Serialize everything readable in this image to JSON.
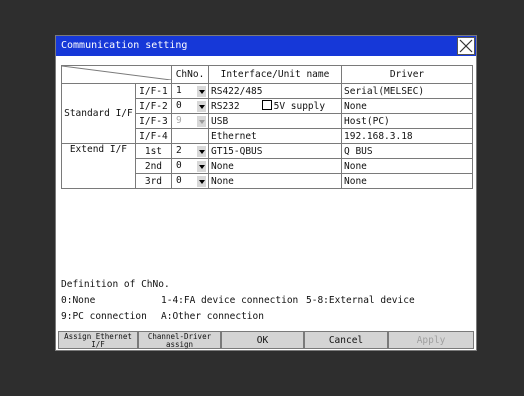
{
  "dialog": {
    "title": "Communication setting",
    "close_icon": "close-icon"
  },
  "table": {
    "headers": {
      "chno": "ChNo.",
      "interface": "Interface/Unit name",
      "driver": "Driver"
    },
    "groups": {
      "standard": "Standard I/F",
      "extend": "Extend I/F"
    },
    "rows": [
      {
        "if": "I/F-1",
        "ch": "1",
        "unit": "RS422/485",
        "driver": "Serial(MELSEC)"
      },
      {
        "if": "I/F-2",
        "ch": "0",
        "unit": "RS232",
        "option": "5V supply",
        "driver": "None"
      },
      {
        "if": "I/F-3",
        "ch": "9",
        "unit": "USB",
        "driver": "Host(PC)"
      },
      {
        "if": "I/F-4",
        "ch": "",
        "unit": "Ethernet",
        "driver": "192.168.3.18"
      },
      {
        "if": "1st",
        "ch": "2",
        "unit": "GT15-QBUS",
        "driver": "Q BUS"
      },
      {
        "if": "2nd",
        "ch": "0",
        "unit": "None",
        "driver": "None"
      },
      {
        "if": "3rd",
        "ch": "0",
        "unit": "None",
        "driver": "None"
      }
    ]
  },
  "legend": {
    "title": "Definition of ChNo.",
    "l1a": "0:None",
    "l1b": "1-4:FA device connection",
    "l1c": "5-8:External device",
    "l2a": "9:PC connection",
    "l2b": "A:Other connection"
  },
  "buttons": {
    "assign_ethernet_1": "Assign Ethernet",
    "assign_ethernet_2": "I/F",
    "channel_driver_1": "Channel-Driver",
    "channel_driver_2": "assign",
    "ok": "OK",
    "cancel": "Cancel",
    "apply": "Apply"
  },
  "colors": {
    "titlebar": "#1638d8",
    "background": "#2e2e2e"
  }
}
